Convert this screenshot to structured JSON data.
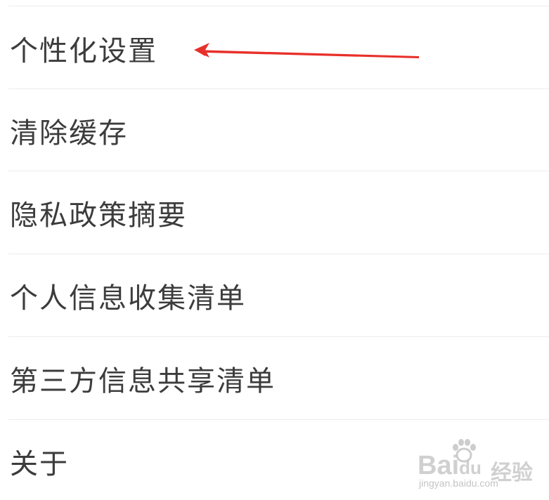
{
  "menu": {
    "items": [
      {
        "label": "个性化设置"
      },
      {
        "label": "清除缓存"
      },
      {
        "label": "隐私政策摘要"
      },
      {
        "label": "个人信息收集清单"
      },
      {
        "label": "第三方信息共享清单"
      },
      {
        "label": "关于"
      }
    ]
  },
  "annotation": {
    "arrow_color": "#e8302a"
  },
  "watermark": {
    "brand": "Bai",
    "brand_suffix": "du",
    "product": "经验",
    "url": "jingyan.baidu.com"
  }
}
